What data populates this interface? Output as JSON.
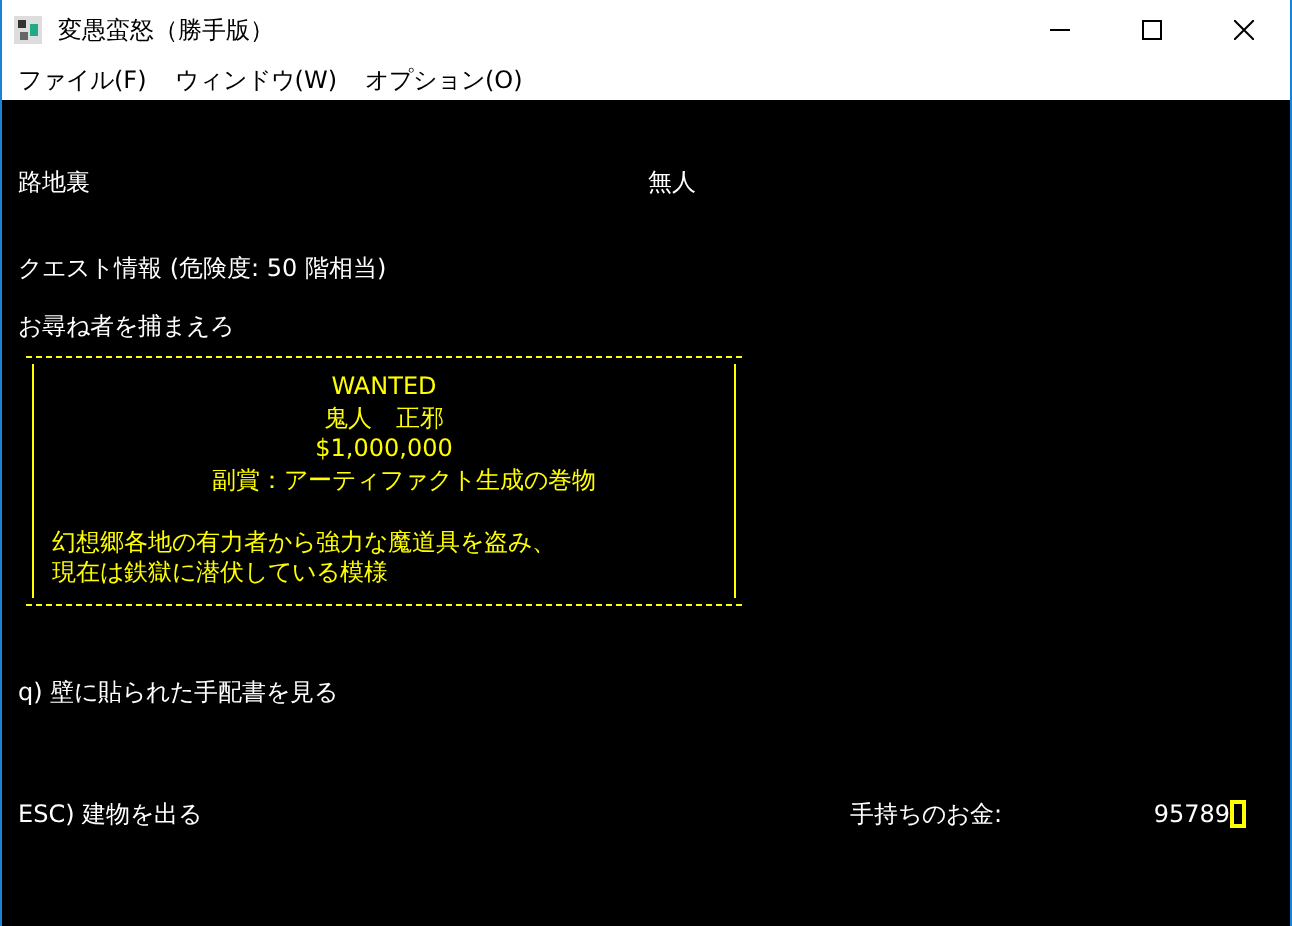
{
  "window": {
    "title": "変愚蛮怒（勝手版）"
  },
  "menu": [
    {
      "label": "ファイル(F)"
    },
    {
      "label": "ウィンドウ(W)"
    },
    {
      "label": "オプション(O)"
    }
  ],
  "terminal": {
    "location": "路地裏",
    "status": "無人",
    "quest_title": "クエスト情報 (危険度: 50 階相当)",
    "quest_name": "お尋ね者を捕まえろ",
    "poster": {
      "heading": "WANTED",
      "target": "鬼人　正邪",
      "bounty": "$1,000,000",
      "bonus": "副賞：アーティファクト生成の巻物",
      "description": [
        "幻想郷各地の有力者から強力な魔道具を盗み、",
        "現在は鉄獄に潜伏している模様"
      ]
    },
    "commands": [
      {
        "key": "q)",
        "label": "壁に貼られた手配書を見る"
      },
      {
        "key": "ESC)",
        "label": "建物を出る"
      }
    ],
    "money_label": "手持ちのお金:",
    "money_value": "95789"
  }
}
